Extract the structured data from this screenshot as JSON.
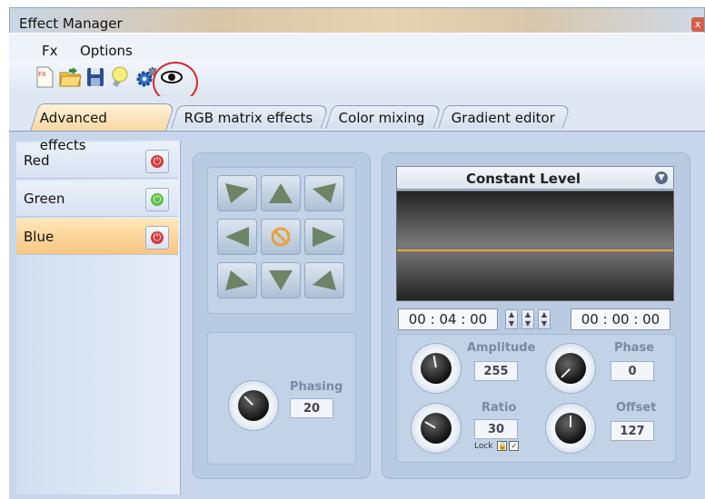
{
  "window": {
    "title": "Effect Manager",
    "close_glyph": "x"
  },
  "menu": {
    "items": [
      {
        "label": "Fx"
      },
      {
        "label": "Options"
      }
    ]
  },
  "toolbar": {
    "icons": [
      "new-fx-icon",
      "open-folder-icon",
      "save-disk-icon",
      "bulb-icon",
      "settings-gears-icon",
      "eye-icon"
    ]
  },
  "tabs": [
    {
      "label": "Advanced effects",
      "active": true
    },
    {
      "label": "RGB matrix effects",
      "active": false
    },
    {
      "label": "Color mixing",
      "active": false
    },
    {
      "label": "Gradient editor",
      "active": false
    }
  ],
  "channels": [
    {
      "label": "Red",
      "power": "off",
      "color": "#d33b3b"
    },
    {
      "label": "Green",
      "power": "on",
      "color": "#5cbf4a"
    },
    {
      "label": "Blue",
      "power": "off",
      "color": "#d33b3b"
    }
  ],
  "movement": {
    "phasing_label": "Phasing",
    "phasing_value": "20"
  },
  "waveform": {
    "type": "Constant Level",
    "start_time": "00 : 04 : 00",
    "end_time": "00 : 00 : 00",
    "line_color": "#e8a33a"
  },
  "params": {
    "amplitude": {
      "label": "Amplitude",
      "value": "255"
    },
    "phase": {
      "label": "Phase",
      "value": "0"
    },
    "ratio": {
      "label": "Ratio",
      "value": "30",
      "lock_label": "Lock"
    },
    "offset": {
      "label": "Offset",
      "value": "127"
    }
  }
}
